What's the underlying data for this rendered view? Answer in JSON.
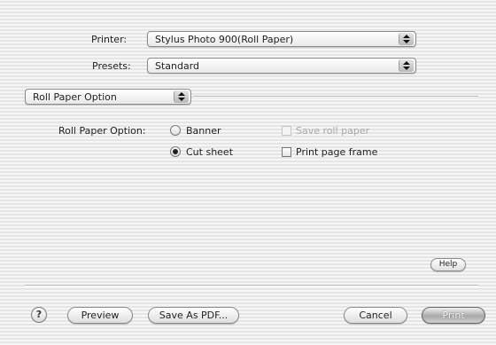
{
  "printer": {
    "label": "Printer:",
    "value": "Stylus Photo 900(Roll Paper)"
  },
  "presets": {
    "label": "Presets:",
    "value": "Standard"
  },
  "panel_selector": {
    "value": "Roll Paper Option"
  },
  "roll_paper": {
    "label": "Roll Paper Option:",
    "radio_options": [
      {
        "label": "Banner",
        "selected": false
      },
      {
        "label": "Cut sheet",
        "selected": true
      }
    ],
    "save_roll_paper": {
      "label": "Save roll paper",
      "checked": false,
      "enabled": false
    },
    "print_page_frame": {
      "label": "Print page frame",
      "checked": false,
      "enabled": true
    }
  },
  "help_small": {
    "label": "Help"
  },
  "footer": {
    "help_glyph": "?",
    "preview_label": "Preview",
    "save_pdf_label": "Save As PDF...",
    "cancel_label": "Cancel",
    "print_label": "Print"
  }
}
